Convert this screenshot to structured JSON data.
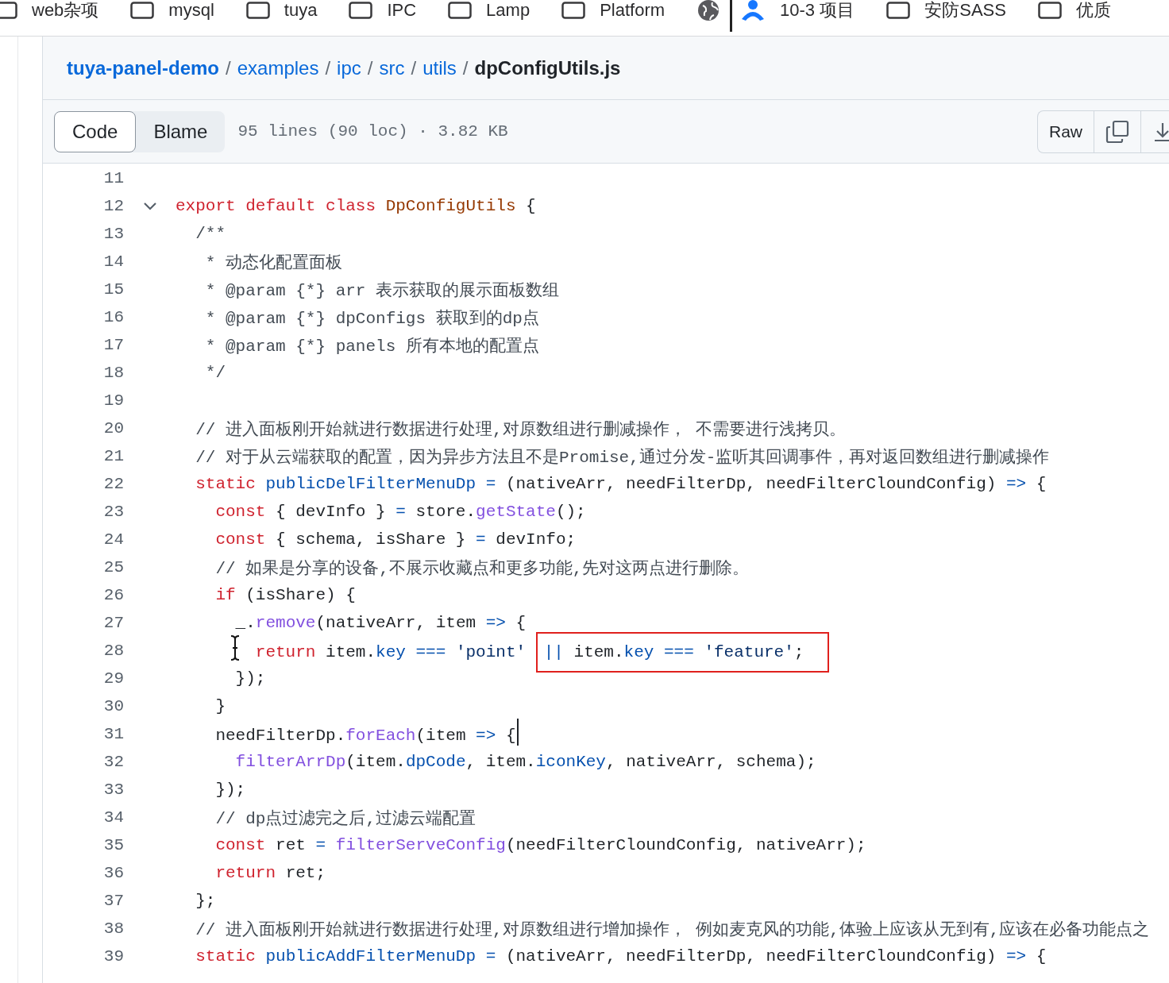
{
  "bookmarks": [
    {
      "kind": "folder",
      "label": "web杂项"
    },
    {
      "kind": "folder",
      "label": "mysql"
    },
    {
      "kind": "folder",
      "label": "tuya"
    },
    {
      "kind": "folder",
      "label": "IPC"
    },
    {
      "kind": "folder",
      "label": "Lamp"
    },
    {
      "kind": "folder",
      "label": "Platform"
    },
    {
      "kind": "globe"
    },
    {
      "kind": "divider"
    },
    {
      "kind": "app",
      "label": "10-3 项目"
    },
    {
      "kind": "folder",
      "label": "安防SASS"
    },
    {
      "kind": "folder",
      "label": "优质"
    }
  ],
  "breadcrumb": [
    {
      "text": "tuya-panel-demo",
      "kind": "repo"
    },
    {
      "text": "/",
      "kind": "separator"
    },
    {
      "text": "examples",
      "kind": "link"
    },
    {
      "text": "/",
      "kind": "separator"
    },
    {
      "text": "ipc",
      "kind": "link"
    },
    {
      "text": "/",
      "kind": "separator"
    },
    {
      "text": "src",
      "kind": "link"
    },
    {
      "text": "/",
      "kind": "separator"
    },
    {
      "text": "utils",
      "kind": "link"
    },
    {
      "text": "/",
      "kind": "separator"
    },
    {
      "text": "dpConfigUtils.js",
      "kind": "current"
    }
  ],
  "toolbar": {
    "tabs": [
      {
        "label": "Code",
        "selected": true
      },
      {
        "label": "Blame",
        "selected": false
      }
    ],
    "file_info": "95 lines (90 loc) · 3.82 KB",
    "raw_button": "Raw"
  },
  "code_lines": [
    {
      "num": "11",
      "foldable": false
    },
    {
      "num": "12",
      "foldable": true,
      "tokens": [
        {
          "kind": "kw",
          "text": "export default class "
        },
        {
          "kind": "cls",
          "text": "DpConfigUtils"
        },
        {
          "kind": "pl",
          "text": " {"
        }
      ]
    },
    {
      "num": "13",
      "foldable": false,
      "tokens": [
        {
          "kind": "cm",
          "text": "  /**"
        }
      ]
    },
    {
      "num": "14",
      "foldable": false,
      "tokens": [
        {
          "kind": "cm",
          "text": "   * 动态化配置面板"
        }
      ]
    },
    {
      "num": "15",
      "foldable": false,
      "tokens": [
        {
          "kind": "cm",
          "text": "   * @param {*} arr 表示获取的展示面板数组"
        }
      ]
    },
    {
      "num": "16",
      "foldable": false,
      "tokens": [
        {
          "kind": "cm",
          "text": "   * @param {*} dpConfigs 获取到的dp点"
        }
      ]
    },
    {
      "num": "17",
      "foldable": false,
      "tokens": [
        {
          "kind": "cm",
          "text": "   * @param {*} panels 所有本地的配置点"
        }
      ]
    },
    {
      "num": "18",
      "foldable": false,
      "tokens": [
        {
          "kind": "cm",
          "text": "   */"
        }
      ]
    },
    {
      "num": "19",
      "foldable": false
    },
    {
      "num": "20",
      "foldable": false,
      "tokens": [
        {
          "kind": "cm",
          "text": "  // 进入面板刚开始就进行数据进行处理,对原数组进行删减操作， 不需要进行浅拷贝。"
        }
      ]
    },
    {
      "num": "21",
      "foldable": false,
      "tokens": [
        {
          "kind": "cm",
          "text": "  // 对于从云端获取的配置，因为异步方法且不是Promise,通过分发-监听其回调事件，再对返回数组进行删减操作"
        }
      ]
    },
    {
      "num": "22",
      "foldable": false,
      "tokens": [
        {
          "kind": "kw",
          "text": "  static "
        },
        {
          "kind": "prop",
          "text": "publicDelFilterMenuDp "
        },
        {
          "kind": "op",
          "text": "="
        },
        {
          "kind": "pl",
          "text": " (nativeArr, needFilterDp, needFilterCloundConfig) "
        },
        {
          "kind": "op",
          "text": "=>"
        },
        {
          "kind": "pl",
          "text": " {"
        }
      ]
    },
    {
      "num": "23",
      "foldable": false,
      "tokens": [
        {
          "kind": "kw",
          "text": "    const"
        },
        {
          "kind": "pl",
          "text": " { devInfo } "
        },
        {
          "kind": "op",
          "text": "="
        },
        {
          "kind": "pl",
          "text": " store."
        },
        {
          "kind": "fn",
          "text": "getState"
        },
        {
          "kind": "pl",
          "text": "();"
        }
      ]
    },
    {
      "num": "24",
      "foldable": false,
      "tokens": [
        {
          "kind": "kw",
          "text": "    const"
        },
        {
          "kind": "pl",
          "text": " { schema, isShare } "
        },
        {
          "kind": "op",
          "text": "="
        },
        {
          "kind": "pl",
          "text": " devInfo;"
        }
      ]
    },
    {
      "num": "25",
      "foldable": false,
      "tokens": [
        {
          "kind": "cm",
          "text": "    // 如果是分享的设备,不展示收藏点和更多功能,先对这两点进行删除。"
        }
      ]
    },
    {
      "num": "26",
      "foldable": false,
      "tokens": [
        {
          "kind": "kw",
          "text": "    if"
        },
        {
          "kind": "pl",
          "text": " (isShare) {"
        }
      ]
    },
    {
      "num": "27",
      "foldable": false,
      "tokens": [
        {
          "kind": "pl",
          "text": "      _."
        },
        {
          "kind": "fn",
          "text": "remove"
        },
        {
          "kind": "pl",
          "text": "(nativeArr, item "
        },
        {
          "kind": "op",
          "text": "=>"
        },
        {
          "kind": "pl",
          "text": " {"
        }
      ]
    },
    {
      "num": "28",
      "foldable": false,
      "tokens": [
        {
          "kind": "ibeam"
        },
        {
          "kind": "kw",
          "text": "        return"
        },
        {
          "kind": "pl",
          "text": " item."
        },
        {
          "kind": "prop",
          "text": "key "
        },
        {
          "kind": "op",
          "text": "==="
        },
        {
          "kind": "str",
          "text": " 'point' "
        },
        {
          "kind": "box",
          "tokens": [
            {
              "kind": "op",
              "text": "||"
            },
            {
              "kind": "pl",
              "text": " item."
            },
            {
              "kind": "prop",
              "text": "key "
            },
            {
              "kind": "op",
              "text": "==="
            },
            {
              "kind": "str",
              "text": " 'feature'"
            },
            {
              "kind": "pl",
              "text": ";"
            }
          ]
        }
      ]
    },
    {
      "num": "29",
      "foldable": false,
      "tokens": [
        {
          "kind": "pl",
          "text": "      });"
        }
      ]
    },
    {
      "num": "30",
      "foldable": false,
      "tokens": [
        {
          "kind": "pl",
          "text": "    }"
        }
      ]
    },
    {
      "num": "31",
      "foldable": false,
      "tokens": [
        {
          "kind": "pl",
          "text": "    needFilterDp."
        },
        {
          "kind": "fn",
          "text": "forEach"
        },
        {
          "kind": "pl",
          "text": "(item "
        },
        {
          "kind": "op",
          "text": "=>"
        },
        {
          "kind": "pl",
          "text": " {"
        },
        {
          "kind": "caret"
        }
      ]
    },
    {
      "num": "32",
      "foldable": false,
      "tokens": [
        {
          "kind": "fn",
          "text": "      filterArrDp"
        },
        {
          "kind": "pl",
          "text": "(item."
        },
        {
          "kind": "prop",
          "text": "dpCode"
        },
        {
          "kind": "pl",
          "text": ", item."
        },
        {
          "kind": "prop",
          "text": "iconKey"
        },
        {
          "kind": "pl",
          "text": ", nativeArr, schema);"
        }
      ]
    },
    {
      "num": "33",
      "foldable": false,
      "tokens": [
        {
          "kind": "pl",
          "text": "    });"
        }
      ]
    },
    {
      "num": "34",
      "foldable": false,
      "tokens": [
        {
          "kind": "cm",
          "text": "    // dp点过滤完之后,过滤云端配置"
        }
      ]
    },
    {
      "num": "35",
      "foldable": false,
      "tokens": [
        {
          "kind": "kw",
          "text": "    const"
        },
        {
          "kind": "pl",
          "text": " ret "
        },
        {
          "kind": "op",
          "text": "="
        },
        {
          "kind": "fn",
          "text": " filterServeConfig"
        },
        {
          "kind": "pl",
          "text": "(needFilterCloundConfig, nativeArr);"
        }
      ]
    },
    {
      "num": "36",
      "foldable": false,
      "tokens": [
        {
          "kind": "kw",
          "text": "    return"
        },
        {
          "kind": "pl",
          "text": " ret;"
        }
      ]
    },
    {
      "num": "37",
      "foldable": false,
      "tokens": [
        {
          "kind": "pl",
          "text": "  };"
        }
      ]
    },
    {
      "num": "38",
      "foldable": false,
      "tokens": [
        {
          "kind": "cm",
          "text": "  // 进入面板刚开始就进行数据进行处理,对原数组进行增加操作， 例如麦克风的功能,体验上应该从无到有,应该在必备功能点之"
        }
      ]
    },
    {
      "num": "39",
      "foldable": false,
      "tokens": [
        {
          "kind": "kw",
          "text": "  static "
        },
        {
          "kind": "prop",
          "text": "publicAddFilterMenuDp "
        },
        {
          "kind": "op",
          "text": "="
        },
        {
          "kind": "pl",
          "text": " (nativeArr, needFilterDp, needFilterCloundConfig) "
        },
        {
          "kind": "op",
          "text": "=>"
        },
        {
          "kind": "pl",
          "text": " {"
        }
      ]
    }
  ]
}
